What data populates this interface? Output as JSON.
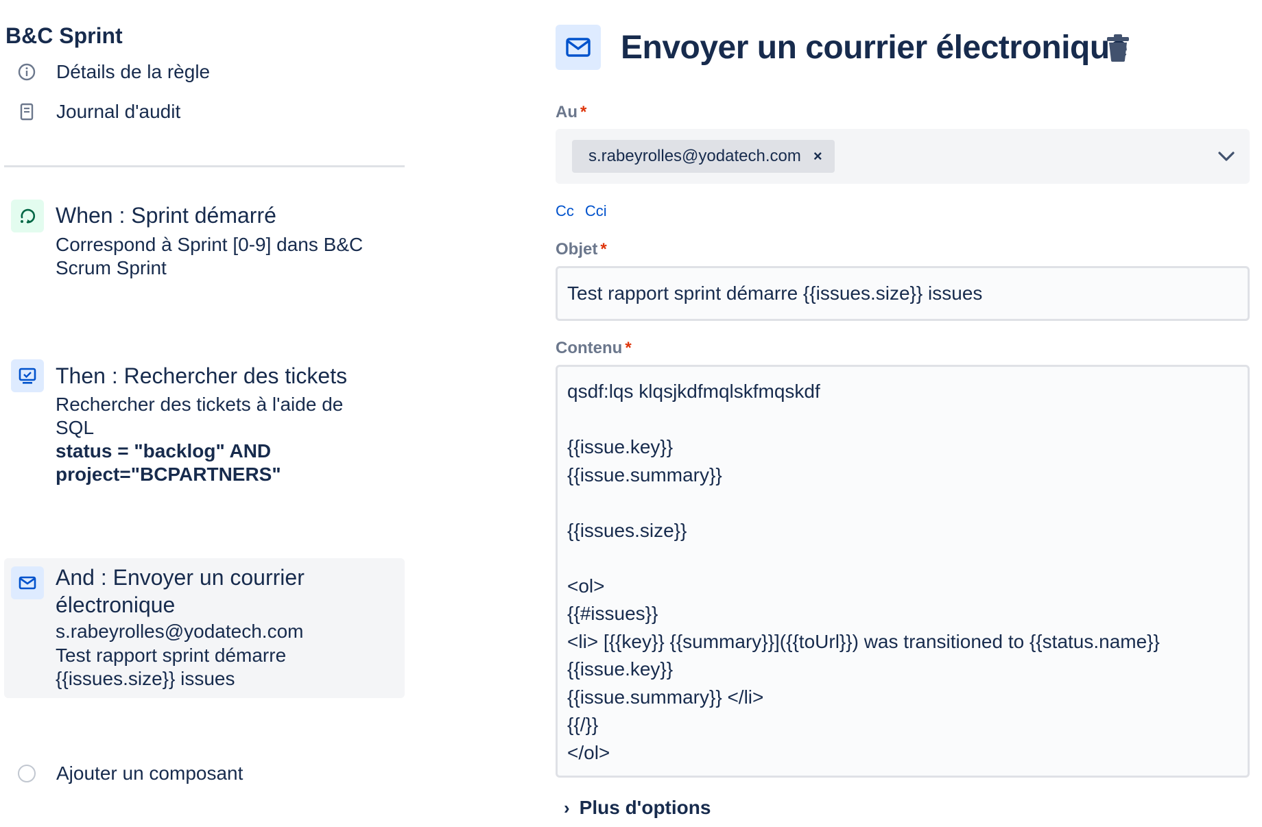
{
  "sidebar": {
    "rule_title": "B&C Sprint",
    "nav": [
      {
        "label": "Détails de la règle",
        "icon": "info-icon"
      },
      {
        "label": "Journal d'audit",
        "icon": "document-icon"
      }
    ],
    "components": [
      {
        "icon": "trigger-icon",
        "title": "When : Sprint démarré",
        "description": "Correspond à Sprint [0-9] dans B&C Scrum Sprint"
      },
      {
        "icon": "search-issues-icon",
        "title": "Then : Rechercher des tickets",
        "description": "Rechercher des tickets à l'aide de SQL",
        "query": "status = \"backlog\" AND project=\"BCPARTNERS\""
      },
      {
        "icon": "mail-icon",
        "title": "And : Envoyer un courrier électronique",
        "line1": "s.rabeyrolles@yodatech.com",
        "line2": "Test rapport sprint démarre {{issues.size}} issues"
      }
    ],
    "add_component": "Ajouter un composant"
  },
  "editor": {
    "title": "Envoyer un courrier électronique",
    "to": {
      "label": "Au",
      "required": "*",
      "chip": "s.rabeyrolles@yodatech.com",
      "chip_remove": "×"
    },
    "cc_label": "Cc",
    "cci_label": "Cci",
    "subject": {
      "label": "Objet",
      "required": "*",
      "value": "Test rapport sprint démarre {{issues.size}} issues"
    },
    "content": {
      "label": "Contenu",
      "required": "*",
      "value": "qsdf:lqs klqsjkdfmqlskfmqskdf\n\n{{issue.key}}\n{{issue.summary}}\n\n{{issues.size}}\n\n<ol>\n{{#issues}}\n<li> [{{key}} {{summary}}]({{toUrl}}) was transitioned to {{status.name}}\n{{issue.key}}\n{{issue.summary}} </li>\n{{/}}\n</ol>"
    },
    "more_options": "Plus d'options",
    "more_arrow": "›"
  },
  "colors": {
    "text": "#172b4d",
    "accent": "#0052cc",
    "required": "#de350b",
    "trigger_bg": "#e3fcef",
    "action_bg": "#deebff"
  }
}
